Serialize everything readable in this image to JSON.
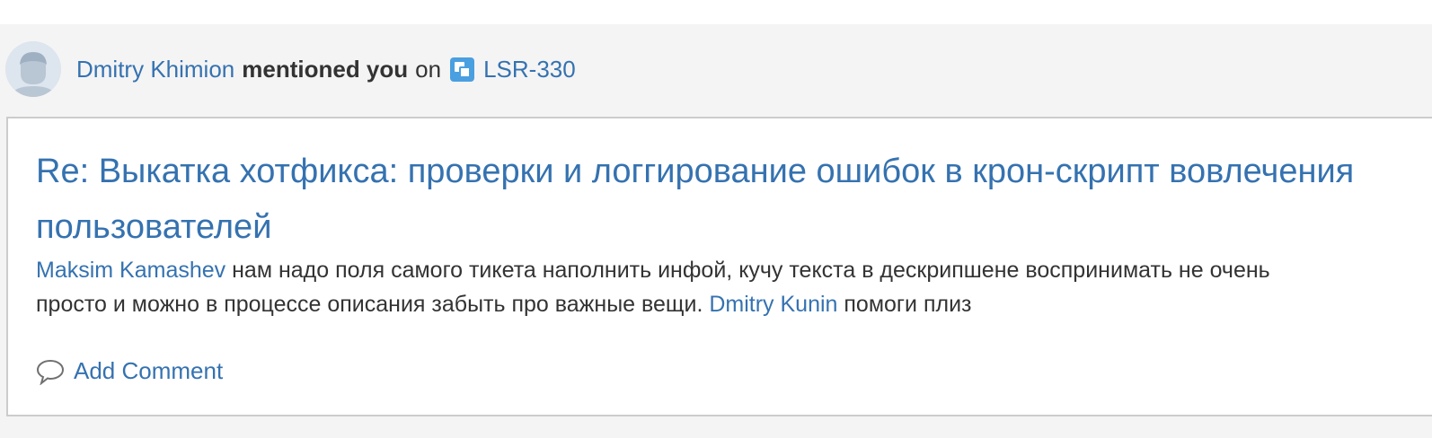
{
  "notification": {
    "actor": "Dmitry Khimion",
    "action": "mentioned you",
    "preposition": "on",
    "issue_key": "LSR-330"
  },
  "comment": {
    "title_line1": "Re: Выкатка хотфикса: проверки и логгирование ошибок в крон-скрипт вовлечения",
    "title_line2": "пользователей",
    "mention1": "Maksim Kamashev",
    "text1": " нам надо поля самого тикета наполнить инфой, кучу текста в дескрипшене воспринимать не очень",
    "text2": "просто и можно в процессе описания забыть про важные вещи. ",
    "mention2": "Dmitry Kunin",
    "text3": " помоги плиз"
  },
  "actions": {
    "add_comment_label": "Add Comment"
  },
  "colors": {
    "link": "#3572b0",
    "panel_bg": "#f4f4f4",
    "issue_icon": "#4a9fe0"
  }
}
